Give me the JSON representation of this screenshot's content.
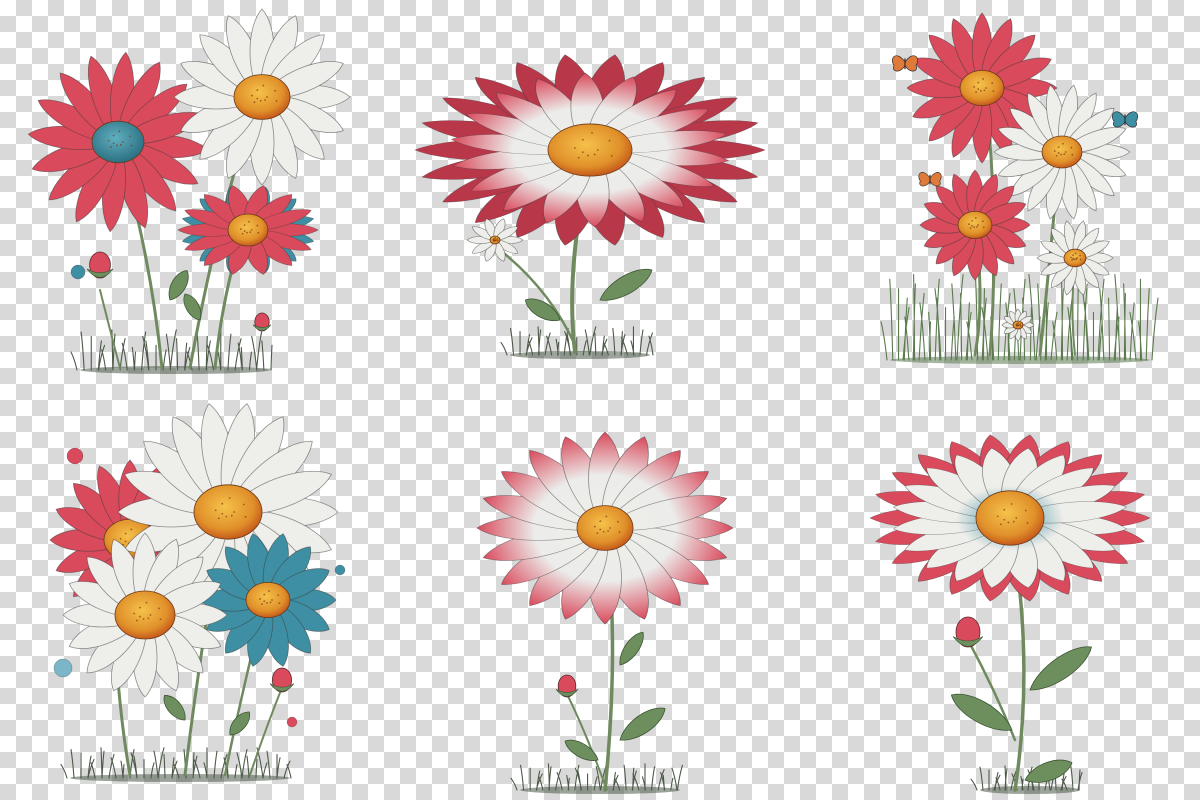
{
  "image": {
    "kind": "clipart-collection",
    "background": "transparency-checkerboard",
    "colors": {
      "checker_light": "#ffffff",
      "checker_dark": "#d9d9d9",
      "red_petal": "#d94a5c",
      "red_petal_dark": "#b8384a",
      "white_petal": "#eeeeea",
      "teal": "#3e8fa3",
      "center_orange": "#e0902a",
      "center_deep": "#d9621f",
      "stem": "#6f8a5e",
      "leaf": "#6d8f5d",
      "grass": "#4d5a48"
    },
    "panels": [
      {
        "name": "cluster-red-white-teal",
        "icon": "daisy-cluster"
      },
      {
        "name": "single-large-red-white",
        "icon": "daisy"
      },
      {
        "name": "daisies-with-butterflies",
        "icon": "daisy-with-butterflies"
      },
      {
        "name": "bouquet-mixed",
        "icon": "daisy-bouquet"
      },
      {
        "name": "single-white-pink-tips",
        "icon": "daisy"
      },
      {
        "name": "single-white-red-outer",
        "icon": "daisy"
      }
    ]
  }
}
